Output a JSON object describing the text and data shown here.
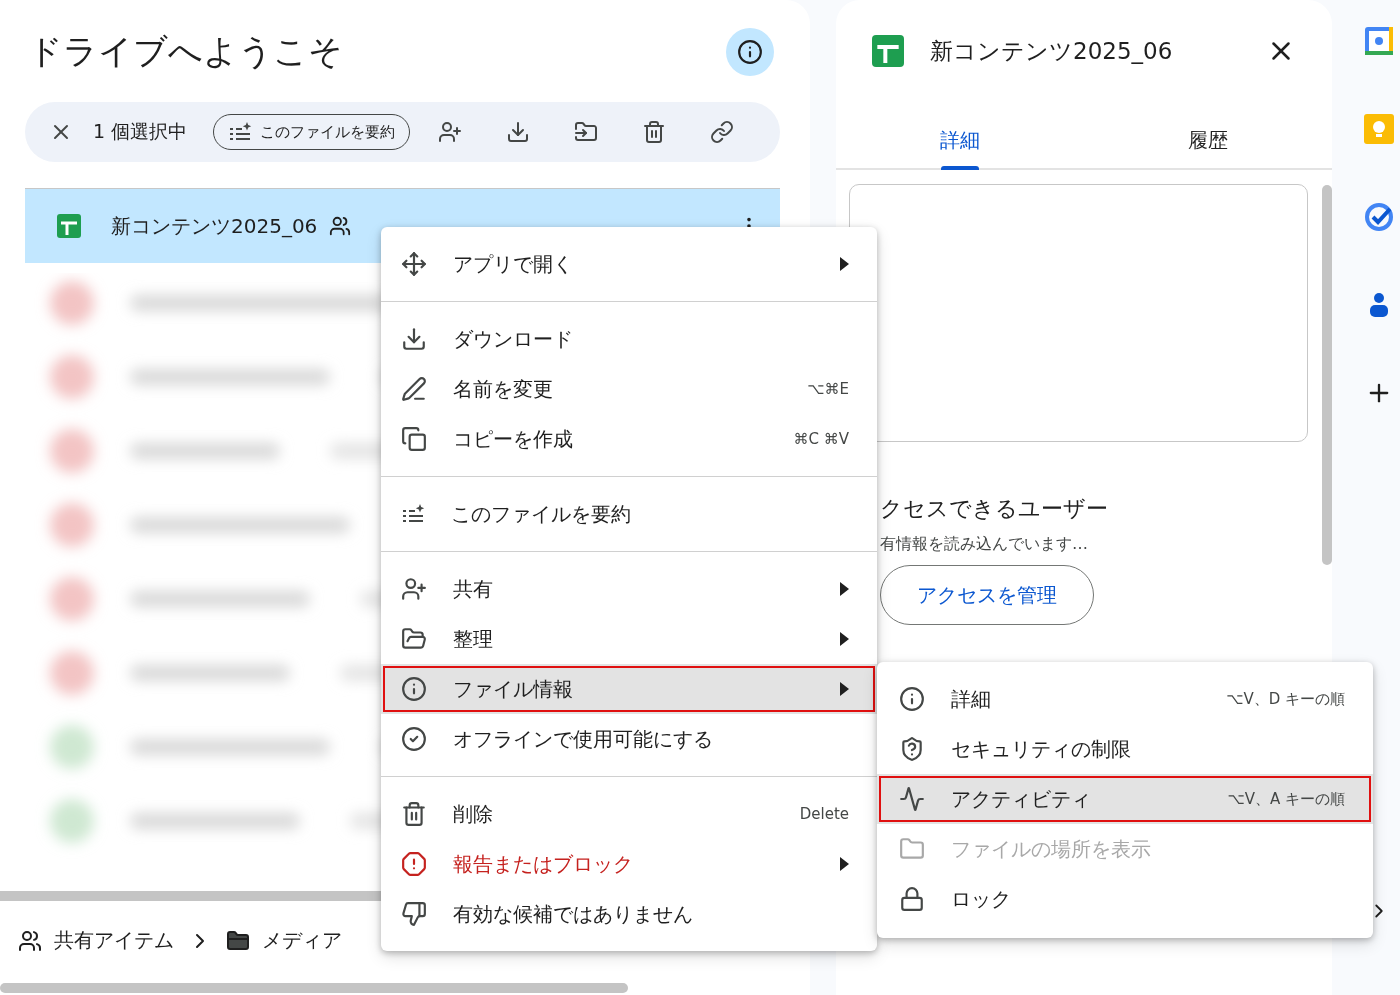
{
  "page_title": "ドライブへようこそ",
  "selection_bar": {
    "count_label": "1 個選択中",
    "summary_chip": "このファイルを要約"
  },
  "file_row": {
    "name": "新コンテンツ2025_06",
    "selected": true
  },
  "breadcrumb": [
    "共有アイテム",
    "メディア"
  ],
  "context_menu": {
    "groups": [
      [
        {
          "label": "アプリで開く",
          "submenu": true,
          "kind": "normal",
          "highlighted": false
        }
      ],
      [
        {
          "label": "ダウンロード",
          "submenu": false,
          "kind": "normal",
          "highlighted": false
        },
        {
          "label": "名前を変更",
          "shortcut": "⌥⌘E",
          "submenu": false,
          "kind": "normal",
          "highlighted": false
        },
        {
          "label": "コピーを作成",
          "shortcut": "⌘C ⌘V",
          "submenu": false,
          "kind": "normal",
          "highlighted": false
        }
      ],
      [
        {
          "label": "このファイルを要約",
          "submenu": false,
          "kind": "normal",
          "highlighted": false
        }
      ],
      [
        {
          "label": "共有",
          "submenu": true,
          "kind": "normal",
          "highlighted": false
        },
        {
          "label": "整理",
          "submenu": true,
          "kind": "normal",
          "highlighted": false
        },
        {
          "label": "ファイル情報",
          "submenu": true,
          "kind": "normal",
          "highlighted": true
        },
        {
          "label": "オフラインで使用可能にする",
          "submenu": false,
          "kind": "normal",
          "highlighted": false
        }
      ],
      [
        {
          "label": "削除",
          "shortcut": "Delete",
          "submenu": false,
          "kind": "normal",
          "highlighted": false
        },
        {
          "label": "報告またはブロック",
          "submenu": true,
          "kind": "danger",
          "highlighted": false
        },
        {
          "label": "有効な候補ではありません",
          "submenu": false,
          "kind": "normal",
          "highlighted": false
        }
      ]
    ]
  },
  "submenu": {
    "items": [
      {
        "label": "詳細",
        "shortcut": "⌥V、D キーの順",
        "disabled": false,
        "highlighted": false
      },
      {
        "label": "セキュリティの制限",
        "disabled": false,
        "highlighted": false
      },
      {
        "label": "アクティビティ",
        "shortcut": "⌥V、A キーの順",
        "disabled": false,
        "highlighted": true
      },
      {
        "label": "ファイルの場所を表示",
        "disabled": true,
        "highlighted": false
      },
      {
        "label": "ロック",
        "disabled": false,
        "highlighted": false
      }
    ]
  },
  "details_panel": {
    "title": "新コンテンツ2025_06",
    "tabs": [
      {
        "label": "詳細",
        "selected": true
      },
      {
        "label": "履歴",
        "selected": false
      }
    ],
    "access_heading": "クセスできるユーザー",
    "loading_text": "有情報を読み込んでいます…",
    "manage_button": "アクセスを管理"
  }
}
